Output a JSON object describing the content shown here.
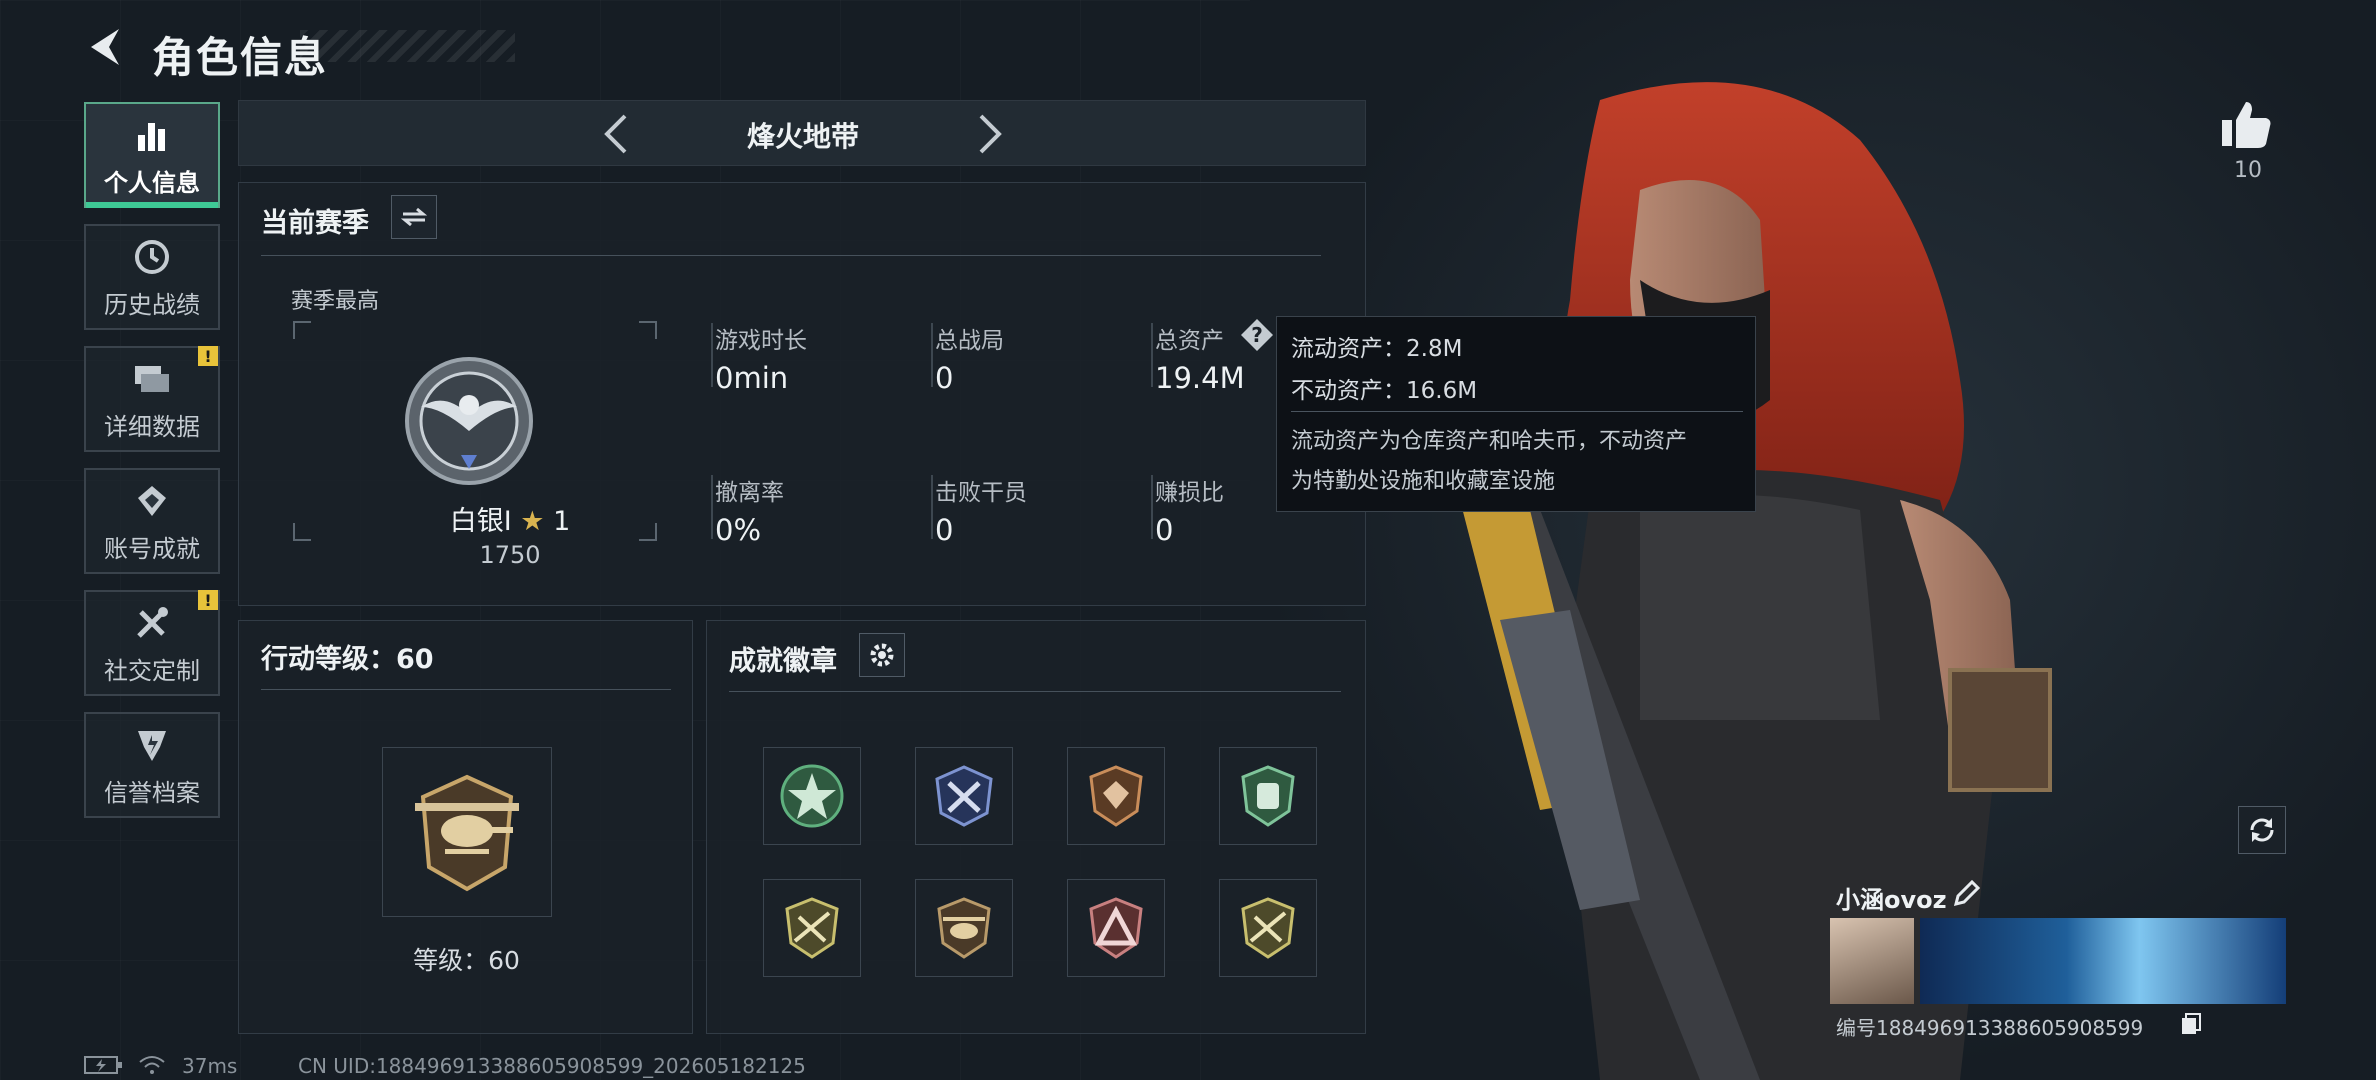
{
  "header": {
    "title": "角色信息"
  },
  "sidebar": {
    "items": [
      {
        "label": "个人信息",
        "active": true,
        "icon": "bar-chart-icon",
        "badge": ""
      },
      {
        "label": "历史战绩",
        "active": false,
        "icon": "history-clock-icon",
        "badge": ""
      },
      {
        "label": "详细数据",
        "active": false,
        "icon": "stacked-cards-icon",
        "badge": "!"
      },
      {
        "label": "账号成就",
        "active": false,
        "icon": "achievement-medal-icon",
        "badge": ""
      },
      {
        "label": "社交定制",
        "active": false,
        "icon": "tools-icon",
        "badge": "!"
      },
      {
        "label": "信誉档案",
        "active": false,
        "icon": "credit-shield-icon",
        "badge": ""
      }
    ]
  },
  "mode": {
    "label": "烽火地带"
  },
  "season": {
    "title": "当前赛季",
    "best_label": "赛季最高",
    "rank_name": "白银I",
    "rank_stars": "1",
    "rank_score": "1750",
    "stats": [
      {
        "label": "游戏时长",
        "value": "0min"
      },
      {
        "label": "总战局",
        "value": "0"
      },
      {
        "label": "总资产",
        "value": "19.4M"
      },
      {
        "label": "撤离率",
        "value": "0%"
      },
      {
        "label": "击败干员",
        "value": "0"
      },
      {
        "label": "赚损比",
        "value": "0"
      }
    ]
  },
  "tooltip": {
    "liquid": "流动资产：2.8M",
    "fixed": "不动资产：16.6M",
    "desc_line1": "流动资产为仓库资产和哈夫币，不动资产",
    "desc_line2": "为特勤处设施和收藏室设施"
  },
  "action_level": {
    "title": "行动等级：60",
    "level_label": "等级：60"
  },
  "achievements": {
    "title": "成就徽章",
    "badges": [
      "star-badge-icon",
      "crossed-arrows-badge-icon",
      "gem-shield-badge-icon",
      "leaf-shield-badge-icon",
      "crossed-rifles-badge-icon",
      "helicopter-badge-icon",
      "triangle-emblem-icon",
      "crossed-rifles-badge-icon"
    ]
  },
  "profile": {
    "likes": "10",
    "name": "小涵ovoz",
    "id": "编号188496913388605908599"
  },
  "status": {
    "ping": "37ms",
    "uid": "CN UID:188496913388605908599_202605182125"
  }
}
